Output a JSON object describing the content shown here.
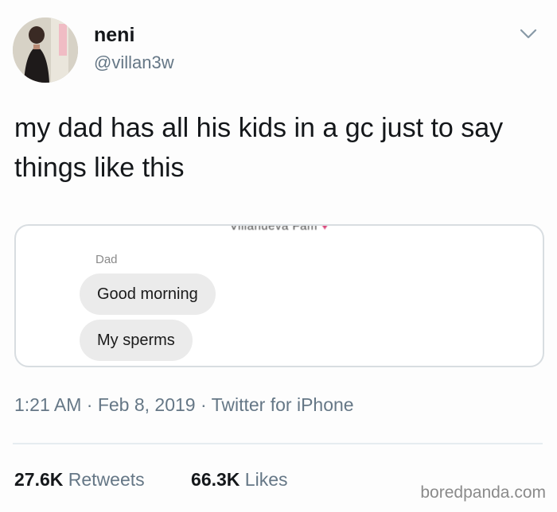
{
  "tweet": {
    "display_name": "neni",
    "handle": "@villan3w",
    "text": "my dad has all his kids in a gc just to say things like this",
    "timestamp": "1:21 AM · Feb 8, 2019 · Twitter for iPhone",
    "retweets_count": "27.6K",
    "retweets_label": "Retweets",
    "likes_count": "66.3K",
    "likes_label": "Likes"
  },
  "icons": {
    "avatar": "profile-photo",
    "caret": "chevron-down-icon"
  },
  "embedded_chat": {
    "header": "Villanueva Fam",
    "header_heart": "♥",
    "sender": "Dad",
    "messages": [
      "Good morning",
      "My sperms"
    ]
  },
  "watermark": "boredpanda.com",
  "colors": {
    "text": "#14171a",
    "secondary": "#657786",
    "bubble": "#ebebeb",
    "border": "#d8dde1"
  }
}
